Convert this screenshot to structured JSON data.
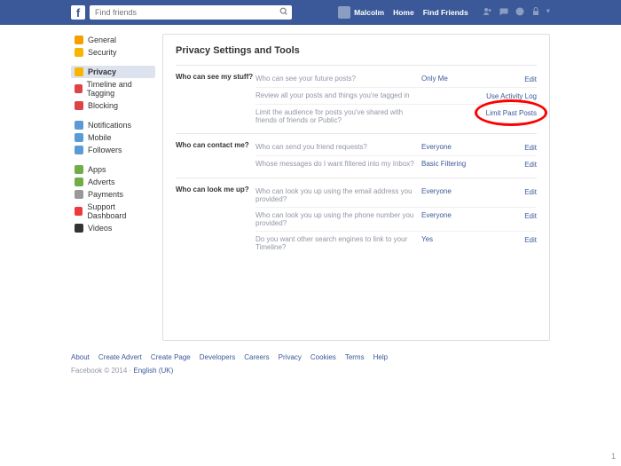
{
  "topbar": {
    "search_placeholder": "Find friends",
    "user_name": "Malcolm",
    "home": "Home",
    "find_friends": "Find Friends"
  },
  "sidebar": {
    "groups": [
      {
        "items": [
          {
            "icon": "#f59f00",
            "label": "General",
            "key": "general"
          },
          {
            "icon": "#f7b500",
            "label": "Security",
            "key": "security"
          }
        ]
      },
      {
        "items": [
          {
            "icon": "#f7b500",
            "label": "Privacy",
            "key": "privacy",
            "active": true
          },
          {
            "icon": "#d44",
            "label": "Timeline and Tagging",
            "key": "timeline"
          },
          {
            "icon": "#d44",
            "label": "Blocking",
            "key": "blocking"
          }
        ]
      },
      {
        "items": [
          {
            "icon": "#5b9bd5",
            "label": "Notifications",
            "key": "notifications"
          },
          {
            "icon": "#5b9bd5",
            "label": "Mobile",
            "key": "mobile"
          },
          {
            "icon": "#5b9bd5",
            "label": "Followers",
            "key": "followers"
          }
        ]
      },
      {
        "items": [
          {
            "icon": "#70ad47",
            "label": "Apps",
            "key": "apps"
          },
          {
            "icon": "#70ad47",
            "label": "Adverts",
            "key": "adverts"
          },
          {
            "icon": "#999",
            "label": "Payments",
            "key": "payments"
          },
          {
            "icon": "#ed3b3b",
            "label": "Support Dashboard",
            "key": "support"
          },
          {
            "icon": "#333",
            "label": "Videos",
            "key": "videos"
          }
        ]
      }
    ]
  },
  "main": {
    "title": "Privacy Settings and Tools",
    "sections": [
      {
        "label": "Who can see my stuff?",
        "rows": [
          {
            "q": "Who can see your future posts?",
            "v": "Only Me",
            "a": "Edit"
          },
          {
            "q": "Review all your posts and things you're tagged in",
            "v": "",
            "a": "Use Activity Log"
          },
          {
            "q": "Limit the audience for posts you've shared with friends of friends or Public?",
            "v": "",
            "a": "Limit Past Posts",
            "highlight": true
          }
        ]
      },
      {
        "label": "Who can contact me?",
        "rows": [
          {
            "q": "Who can send you friend requests?",
            "v": "Everyone",
            "a": "Edit"
          },
          {
            "q": "Whose messages do I want filtered into my Inbox?",
            "v": "Basic Filtering",
            "a": "Edit"
          }
        ]
      },
      {
        "label": "Who can look me up?",
        "rows": [
          {
            "q": "Who can look you up using the email address you provided?",
            "v": "Everyone",
            "a": "Edit"
          },
          {
            "q": "Who can look you up using the phone number you provided?",
            "v": "Everyone",
            "a": "Edit"
          },
          {
            "q": "Do you want other search engines to link to your Timeline?",
            "v": "Yes",
            "a": "Edit"
          }
        ]
      }
    ]
  },
  "footer": {
    "links": [
      "About",
      "Create Advert",
      "Create Page",
      "Developers",
      "Careers",
      "Privacy",
      "Cookies",
      "Terms",
      "Help"
    ],
    "copyright": "Facebook © 2014 ·",
    "lang": "English (UK)"
  },
  "page_indicator": "1"
}
